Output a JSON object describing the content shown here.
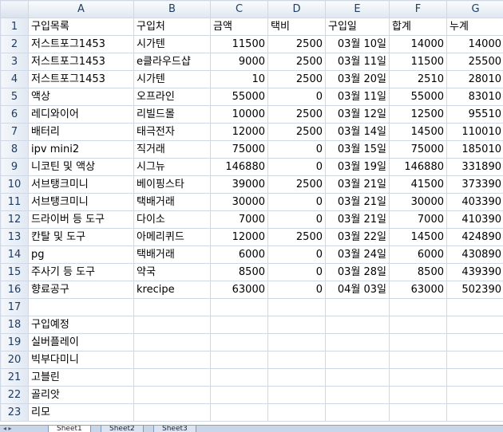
{
  "columns": [
    "A",
    "B",
    "C",
    "D",
    "E",
    "F",
    "G"
  ],
  "rows": [
    {
      "n": "1",
      "cells": [
        "구입목록",
        "구입처",
        "금액",
        "택비",
        "구입일",
        "합계",
        "누계"
      ]
    },
    {
      "n": "2",
      "cells": [
        "저스트포그1453",
        "시가텐",
        "11500",
        "2500",
        "03월 10일",
        "14000",
        "14000"
      ]
    },
    {
      "n": "3",
      "cells": [
        "저스트포그1453",
        "e클라우드샵",
        "9000",
        "2500",
        "03월 11일",
        "11500",
        "25500"
      ]
    },
    {
      "n": "4",
      "cells": [
        "저스트포그1453",
        "시가텐",
        "10",
        "2500",
        "03월 20일",
        "2510",
        "28010"
      ]
    },
    {
      "n": "5",
      "cells": [
        "액상",
        "오프라인",
        "55000",
        "0",
        "03월 11일",
        "55000",
        "83010"
      ]
    },
    {
      "n": "6",
      "cells": [
        "레디와이어",
        "리빌드몰",
        "10000",
        "2500",
        "03월 12일",
        "12500",
        "95510"
      ]
    },
    {
      "n": "7",
      "cells": [
        "배터리",
        "태극전자",
        "12000",
        "2500",
        "03월 14일",
        "14500",
        "110010"
      ]
    },
    {
      "n": "8",
      "cells": [
        "ipv mini2",
        "직거래",
        "75000",
        "0",
        "03월 15일",
        "75000",
        "185010"
      ]
    },
    {
      "n": "9",
      "cells": [
        "니코틴 및 액상",
        "시그뉴",
        "146880",
        "0",
        "03월 19일",
        "146880",
        "331890"
      ]
    },
    {
      "n": "10",
      "cells": [
        "서브탱크미니",
        "베이핑스타",
        "39000",
        "2500",
        "03월 21일",
        "41500",
        "373390"
      ]
    },
    {
      "n": "11",
      "cells": [
        "서브탱크미니",
        "택배거래",
        "30000",
        "0",
        "03월 21일",
        "30000",
        "403390"
      ]
    },
    {
      "n": "12",
      "cells": [
        "드라이버 등 도구",
        "다이소",
        "7000",
        "0",
        "03월 21일",
        "7000",
        "410390"
      ]
    },
    {
      "n": "13",
      "cells": [
        "칸탈 및 도구",
        "아메리퀴드",
        "12000",
        "2500",
        "03월 22일",
        "14500",
        "424890"
      ]
    },
    {
      "n": "14",
      "cells": [
        "pg",
        "택배거래",
        "6000",
        "0",
        "03월 24일",
        "6000",
        "430890"
      ]
    },
    {
      "n": "15",
      "cells": [
        "주사기 등 도구",
        "약국",
        "8500",
        "0",
        "03월 28일",
        "8500",
        "439390"
      ]
    },
    {
      "n": "16",
      "cells": [
        "향료공구",
        "krecipe",
        "63000",
        "0",
        "04월 03일",
        "63000",
        "502390"
      ]
    },
    {
      "n": "17",
      "cells": [
        "",
        "",
        "",
        "",
        "",
        "",
        ""
      ]
    },
    {
      "n": "18",
      "cells": [
        "구입예정",
        "",
        "",
        "",
        "",
        "",
        ""
      ]
    },
    {
      "n": "19",
      "cells": [
        "실버플레이",
        "",
        "",
        "",
        "",
        "",
        ""
      ]
    },
    {
      "n": "20",
      "cells": [
        "빅부다미니",
        "",
        "",
        "",
        "",
        "",
        ""
      ]
    },
    {
      "n": "21",
      "cells": [
        "고블린",
        "",
        "",
        "",
        "",
        "",
        ""
      ]
    },
    {
      "n": "22",
      "cells": [
        "골리앗",
        "",
        "",
        "",
        "",
        "",
        ""
      ]
    },
    {
      "n": "23",
      "cells": [
        "리모",
        "",
        "",
        "",
        "",
        "",
        ""
      ]
    }
  ],
  "sheet_tabs": [
    "Sheet1",
    "Sheet2",
    "Sheet3"
  ],
  "colors": {
    "grid": "#d0d7e5",
    "header": "#dfe7f1"
  }
}
